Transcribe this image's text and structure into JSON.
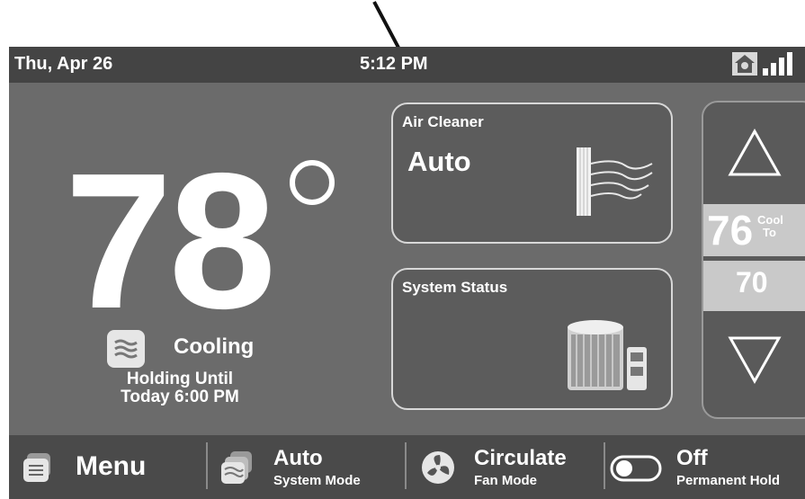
{
  "status_bar": {
    "date": "Thu, Apr 26",
    "time": "5:12 PM",
    "icons": [
      "home-icon",
      "signal-icon"
    ]
  },
  "current": {
    "temperature": "78",
    "mode_label": "Cooling",
    "hold_line1": "Holding Until",
    "hold_line2": "Today 6:00 PM"
  },
  "air_cleaner": {
    "title": "Air Cleaner",
    "value": "Auto"
  },
  "system_status": {
    "title": "System Status"
  },
  "setpoints": {
    "cool_value": "76",
    "cool_label_1": "Cool",
    "cool_label_2": "To",
    "heat_value": "70"
  },
  "bottom_bar": {
    "menu_label": "Menu",
    "system_mode_value": "Auto",
    "system_mode_label": "System Mode",
    "fan_mode_value": "Circulate",
    "fan_mode_label": "Fan Mode",
    "hold_value": "Off",
    "hold_label": "Permanent Hold"
  },
  "colors": {
    "screen_bg": "#6b6b6b",
    "bar_bg": "#444444",
    "setpoint_bg": "#c9c9c9",
    "text": "#ffffff"
  }
}
